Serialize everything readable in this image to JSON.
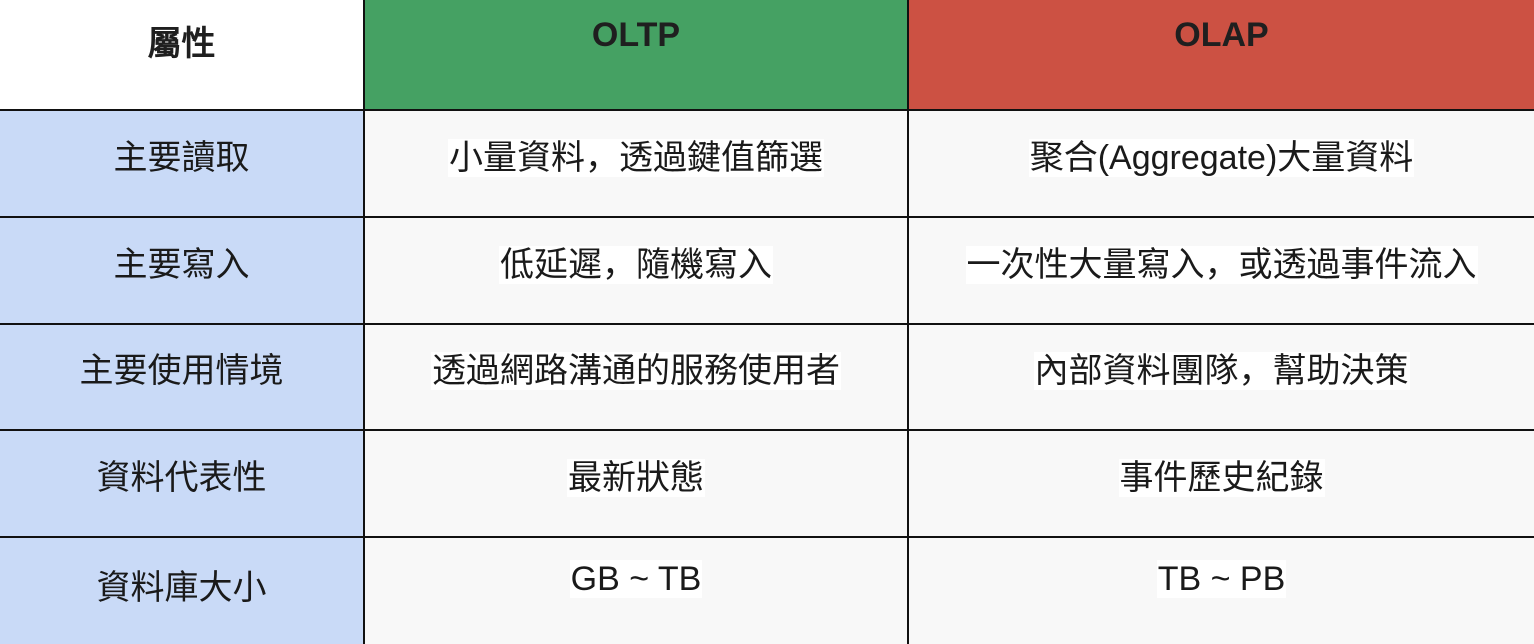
{
  "table": {
    "headers": [
      {
        "label": "屬性",
        "color": "#ffffff"
      },
      {
        "label": "OLTP",
        "color": "#45a163"
      },
      {
        "label": "OLAP",
        "color": "#cc5143"
      }
    ],
    "rows": [
      {
        "attribute": "主要讀取",
        "oltp": "小量資料，透過鍵值篩選",
        "olap": "聚合(Aggregate)大量資料"
      },
      {
        "attribute": "主要寫入",
        "oltp": "低延遲，隨機寫入",
        "olap": "一次性大量寫入，或透過事件流入"
      },
      {
        "attribute": "主要使用情境",
        "oltp": "透過網路溝通的服務使用者",
        "olap": "內部資料團隊，幫助決策"
      },
      {
        "attribute": "資料代表性",
        "oltp": "最新狀態",
        "olap": "事件歷史紀錄"
      },
      {
        "attribute": "資料庫大小",
        "oltp": "GB ~ TB",
        "olap": "TB ~ PB"
      }
    ]
  },
  "colors": {
    "attribute_column": "#c9daf7",
    "value_cells": "#f8f8f8"
  }
}
